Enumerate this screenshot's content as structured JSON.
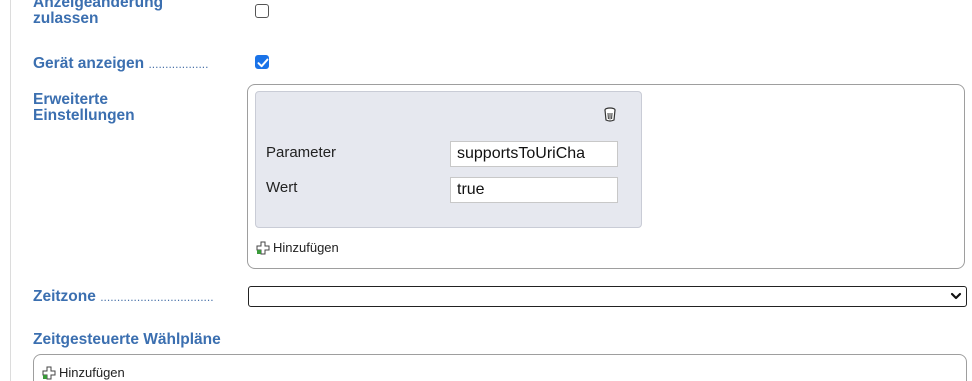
{
  "form": {
    "allow_display_change": {
      "label_line1": "Anzeigeänderung",
      "label_line2": "zulassen",
      "checked": false
    },
    "show_device": {
      "label": "Gerät anzeigen",
      "dots": "..................",
      "checked": true
    },
    "advanced_settings": {
      "label_line1": "Erweiterte",
      "label_line2": "Einstellungen",
      "parameter_label": "Parameter",
      "parameter_value": "supportsToUriCha",
      "value_label": "Wert",
      "value_value": "true",
      "add_label": "Hinzufügen"
    },
    "timezone": {
      "label": "Zeitzone",
      "dots": "..................................",
      "selected": ""
    },
    "time_dial_plans": {
      "label": "Zeitgesteuerte Wählpläne",
      "add_label": "Hinzufügen"
    }
  },
  "colors": {
    "label_blue": "#3b6fb0",
    "checkbox_blue": "#1a73e8",
    "panel_bg": "#e6e8ef"
  },
  "icons": {
    "delete": "trash-can-icon",
    "add": "plus-icon",
    "dropdown": "chevron-down-icon"
  }
}
